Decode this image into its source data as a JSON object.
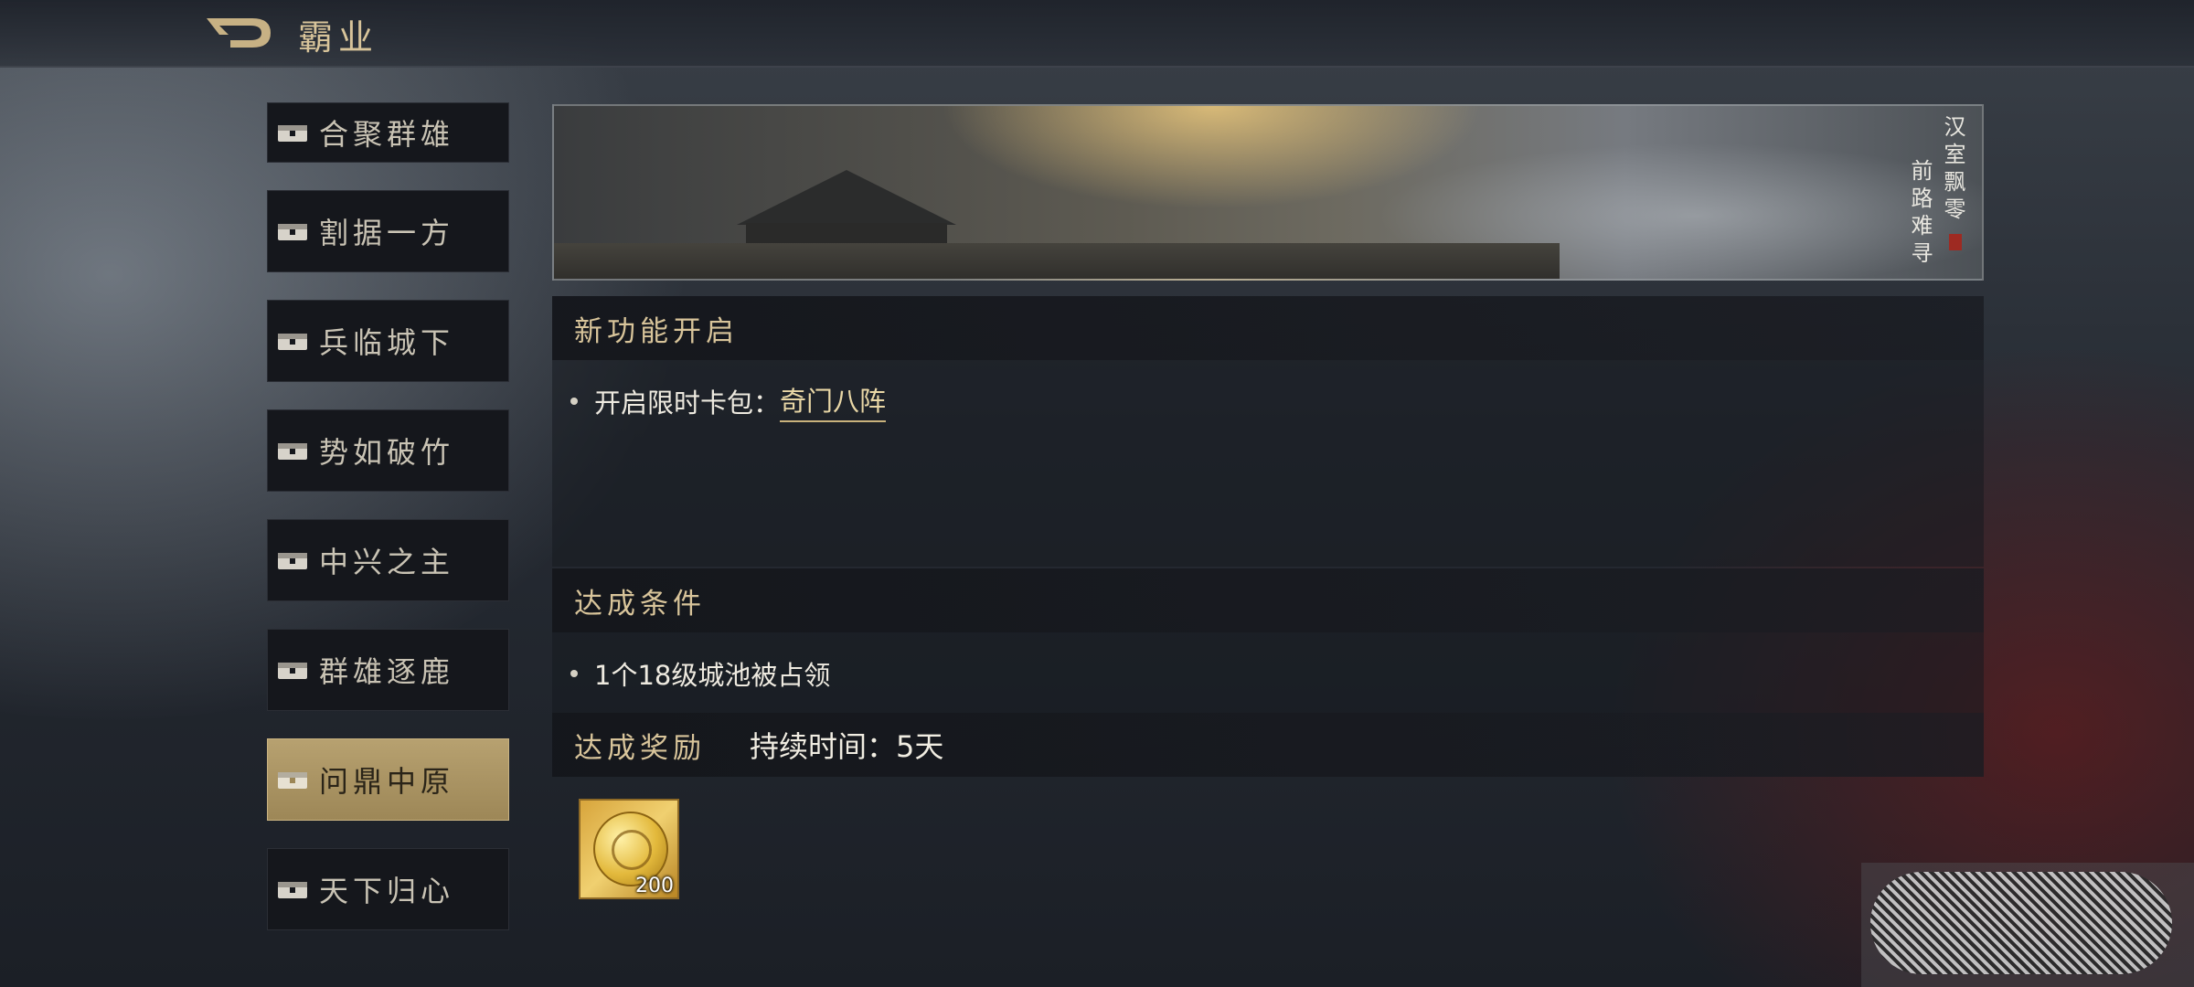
{
  "header": {
    "title": "霸业"
  },
  "sidebar": {
    "items": [
      {
        "label": "合聚群雄",
        "active": false
      },
      {
        "label": "割据一方",
        "active": false
      },
      {
        "label": "兵临城下",
        "active": false
      },
      {
        "label": "势如破竹",
        "active": false
      },
      {
        "label": "中兴之主",
        "active": false
      },
      {
        "label": "群雄逐鹿",
        "active": false
      },
      {
        "label": "问鼎中原",
        "active": true
      },
      {
        "label": "天下归心",
        "active": false
      }
    ]
  },
  "banner": {
    "line1": "汉室飘零",
    "line2": "前路难寻"
  },
  "feature": {
    "heading": "新功能开启",
    "item_prefix": "开启限时卡包：",
    "item_link": "奇门八阵"
  },
  "condition": {
    "heading": "达成条件",
    "item": "1个18级城池被占领"
  },
  "reward": {
    "heading": "达成奖励",
    "duration": "持续时间：5天",
    "items": [
      {
        "icon": "gold-coin-icon",
        "quantity": "200"
      }
    ]
  },
  "colors": {
    "accent": "#d8c49a",
    "active_tab": "#b7a170",
    "panel": "#15171c"
  }
}
